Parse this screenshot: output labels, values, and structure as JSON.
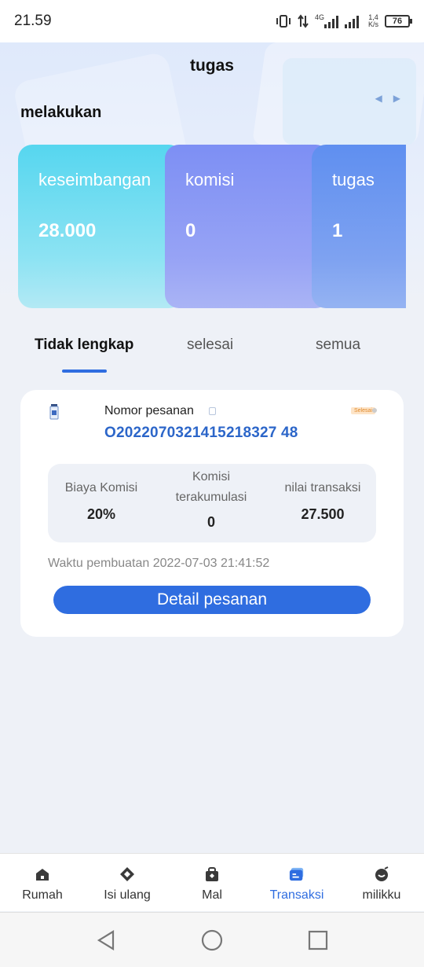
{
  "status_bar": {
    "time": "21.59",
    "network": "4G",
    "speed_value": "1,4",
    "speed_unit": "K/s",
    "battery": "76"
  },
  "header": {
    "title": "tugas",
    "section_label": "melakukan"
  },
  "cards": [
    {
      "label": "keseimbangan",
      "value": "28.000"
    },
    {
      "label": "komisi",
      "value": "0"
    },
    {
      "label": "tugas",
      "value": "1"
    }
  ],
  "tabs": [
    {
      "label": "Tidak lengkap",
      "active": true
    },
    {
      "label": "selesai",
      "active": false
    },
    {
      "label": "semua",
      "active": false
    }
  ],
  "order": {
    "number_label": "Nomor pesanan",
    "status": "Selesai",
    "number": "O2022070321415218327 48",
    "stats": [
      {
        "label": "Biaya Komisi",
        "value": "20%"
      },
      {
        "label_line1": "Komisi",
        "label_line2": "terakumulasi",
        "value": "0"
      },
      {
        "label": "nilai transaksi",
        "value": "27.500"
      }
    ],
    "created": "Waktu pembuatan 2022-07-03 21:41:52",
    "detail_button": "Detail pesanan"
  },
  "bottom_nav": [
    {
      "label": "Rumah",
      "icon": "home-icon",
      "active": false
    },
    {
      "label": "Isi ulang",
      "icon": "recharge-icon",
      "active": false
    },
    {
      "label": "Mal",
      "icon": "mall-icon",
      "active": false
    },
    {
      "label": "Transaksi",
      "icon": "transaction-icon",
      "active": true
    },
    {
      "label": "milikku",
      "icon": "profile-icon",
      "active": false
    }
  ],
  "colors": {
    "accent": "#2f6de0",
    "order_number": "#2c66c9",
    "card_balance": "#56d6ef",
    "card_commission": "#7d8ff4",
    "card_tasks": "#5f8ff0"
  }
}
